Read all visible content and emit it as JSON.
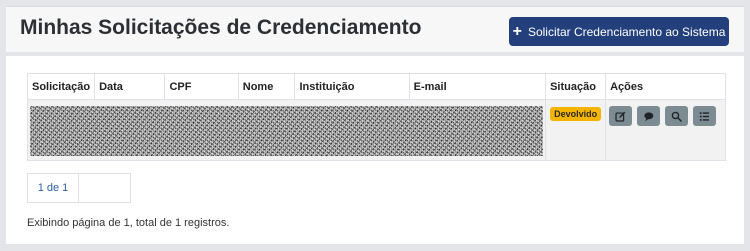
{
  "header": {
    "title": "Minhas Solicitações de Credenciamento",
    "action_label": "Solicitar Credenciamento ao Sistema",
    "action_icon": "plus-icon"
  },
  "table": {
    "columns": [
      "Solicitação",
      "Data",
      "CPF",
      "Nome",
      "Instituição",
      "E-mail",
      "Situação",
      "Ações"
    ],
    "rows": [
      {
        "status": "Devolvido",
        "status_color": "#f4b400",
        "actions": [
          "edit-icon",
          "comment-icon",
          "search-icon",
          "list-icon"
        ]
      }
    ]
  },
  "pagination": {
    "current": "1 de 1"
  },
  "footer": {
    "summary": "Exibindo página de 1, total de 1 registros."
  },
  "colors": {
    "primary": "#23407c",
    "action_button": "#7d8b93",
    "link": "#2d5fa3"
  }
}
